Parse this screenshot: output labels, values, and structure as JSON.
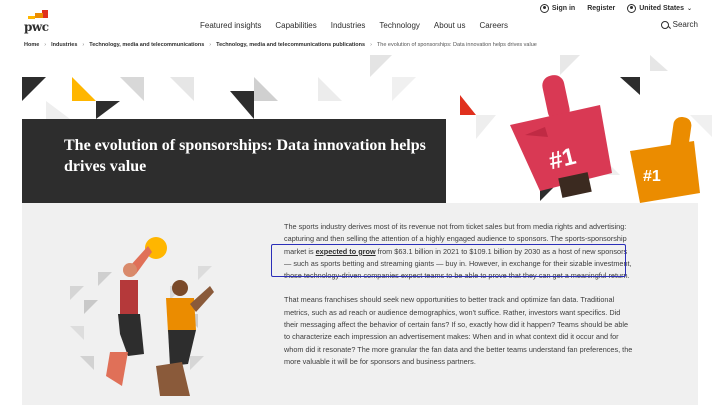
{
  "header": {
    "logo_text": "pwc",
    "utility": {
      "signin": "Sign in",
      "register": "Register",
      "region": "United States"
    },
    "nav": [
      "Featured insights",
      "Capabilities",
      "Industries",
      "Technology",
      "About us",
      "Careers"
    ],
    "search_label": "Search"
  },
  "breadcrumb": [
    "Home",
    "Industries",
    "Technology, media and telecommunications",
    "Technology, media and telecommunications publications",
    "The evolution of sponsorships: Data innovation helps drives value"
  ],
  "hero": {
    "title": "The evolution of sponsorships: Data innovation helps drives value",
    "foam_finger_text": "#1"
  },
  "article": {
    "p1_before": "The sports industry derives most of its revenue not from ticket sales but from media rights and advertising: capturing and then selling the attention of a highly engaged audience to sponsors. The sports-sponsorship market is ",
    "p1_link": "expected to grow",
    "p1_after": " from $63.1 billion in 2021 to $109.1 billion by 2030 as a host of new sponsors — such as sports betting and streaming giants — buy in. However, in exchange for their sizable investment, those technology-driven companies expect teams to be able to prove that they can get a meaningful return.",
    "p2": "That means franchises should seek new opportunities to better track and optimize fan data. Traditional metrics, such as ad reach or audience demographics, won't suffice. Rather, investors want specifics. Did their messaging affect the behavior of certain fans? If so, exactly how did it happen? Teams should be able to characterize each impression an advertisement makes: When and in what context did it occur and for whom did it resonate? The more granular the fan data and the better teams understand fan preferences, the more valuable it will be for sponsors and business partners."
  },
  "colors": {
    "brand_red": "#e0301e",
    "brand_orange": "#eb8c00",
    "brand_yellow": "#ffb600",
    "highlight_blue": "#2b2fb8"
  }
}
